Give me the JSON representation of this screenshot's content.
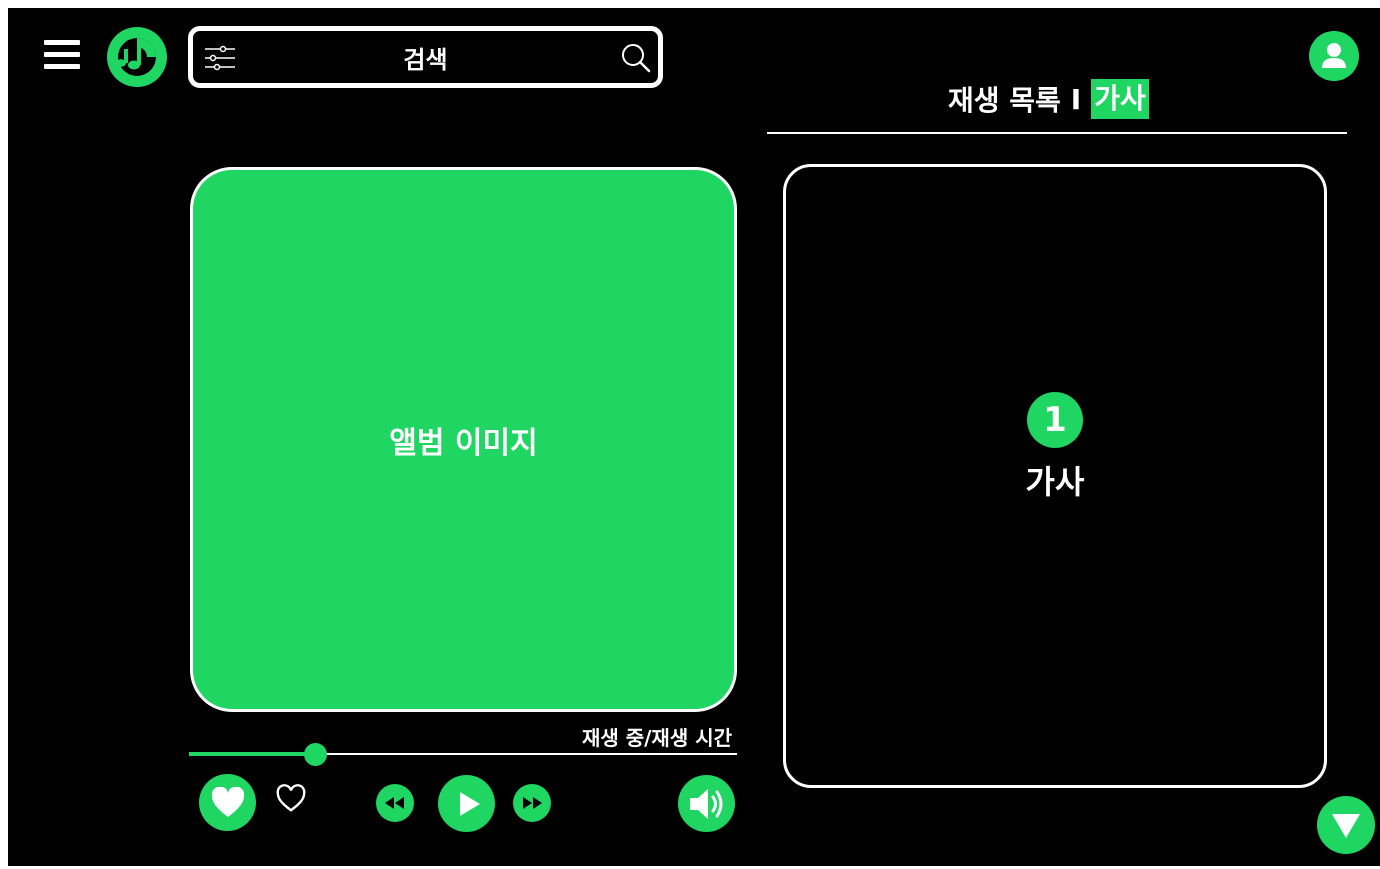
{
  "search": {
    "placeholder": "검색"
  },
  "tabs": {
    "playlist": "재생 목록",
    "separator": "I",
    "lyrics": "가사",
    "active": "lyrics"
  },
  "album": {
    "label": "앨범 이미지"
  },
  "player": {
    "time_label": "재생 중/재생 시간",
    "progress": 0.23
  },
  "lyrics": {
    "number": "1",
    "text": "가사"
  },
  "icons": {
    "menu": "menu-icon",
    "logo": "music-note-icon",
    "filter": "sliders-icon",
    "search": "search-icon",
    "user": "user-icon",
    "like": "heart-filled-icon",
    "like_outline": "heart-outline-icon",
    "rewind": "rewind-icon",
    "play": "play-icon",
    "fast_forward": "fast-forward-icon",
    "volume": "volume-icon",
    "down": "triangle-down-icon"
  },
  "colors": {
    "accent": "#1fd662",
    "background": "#000000",
    "foreground": "#ffffff"
  }
}
